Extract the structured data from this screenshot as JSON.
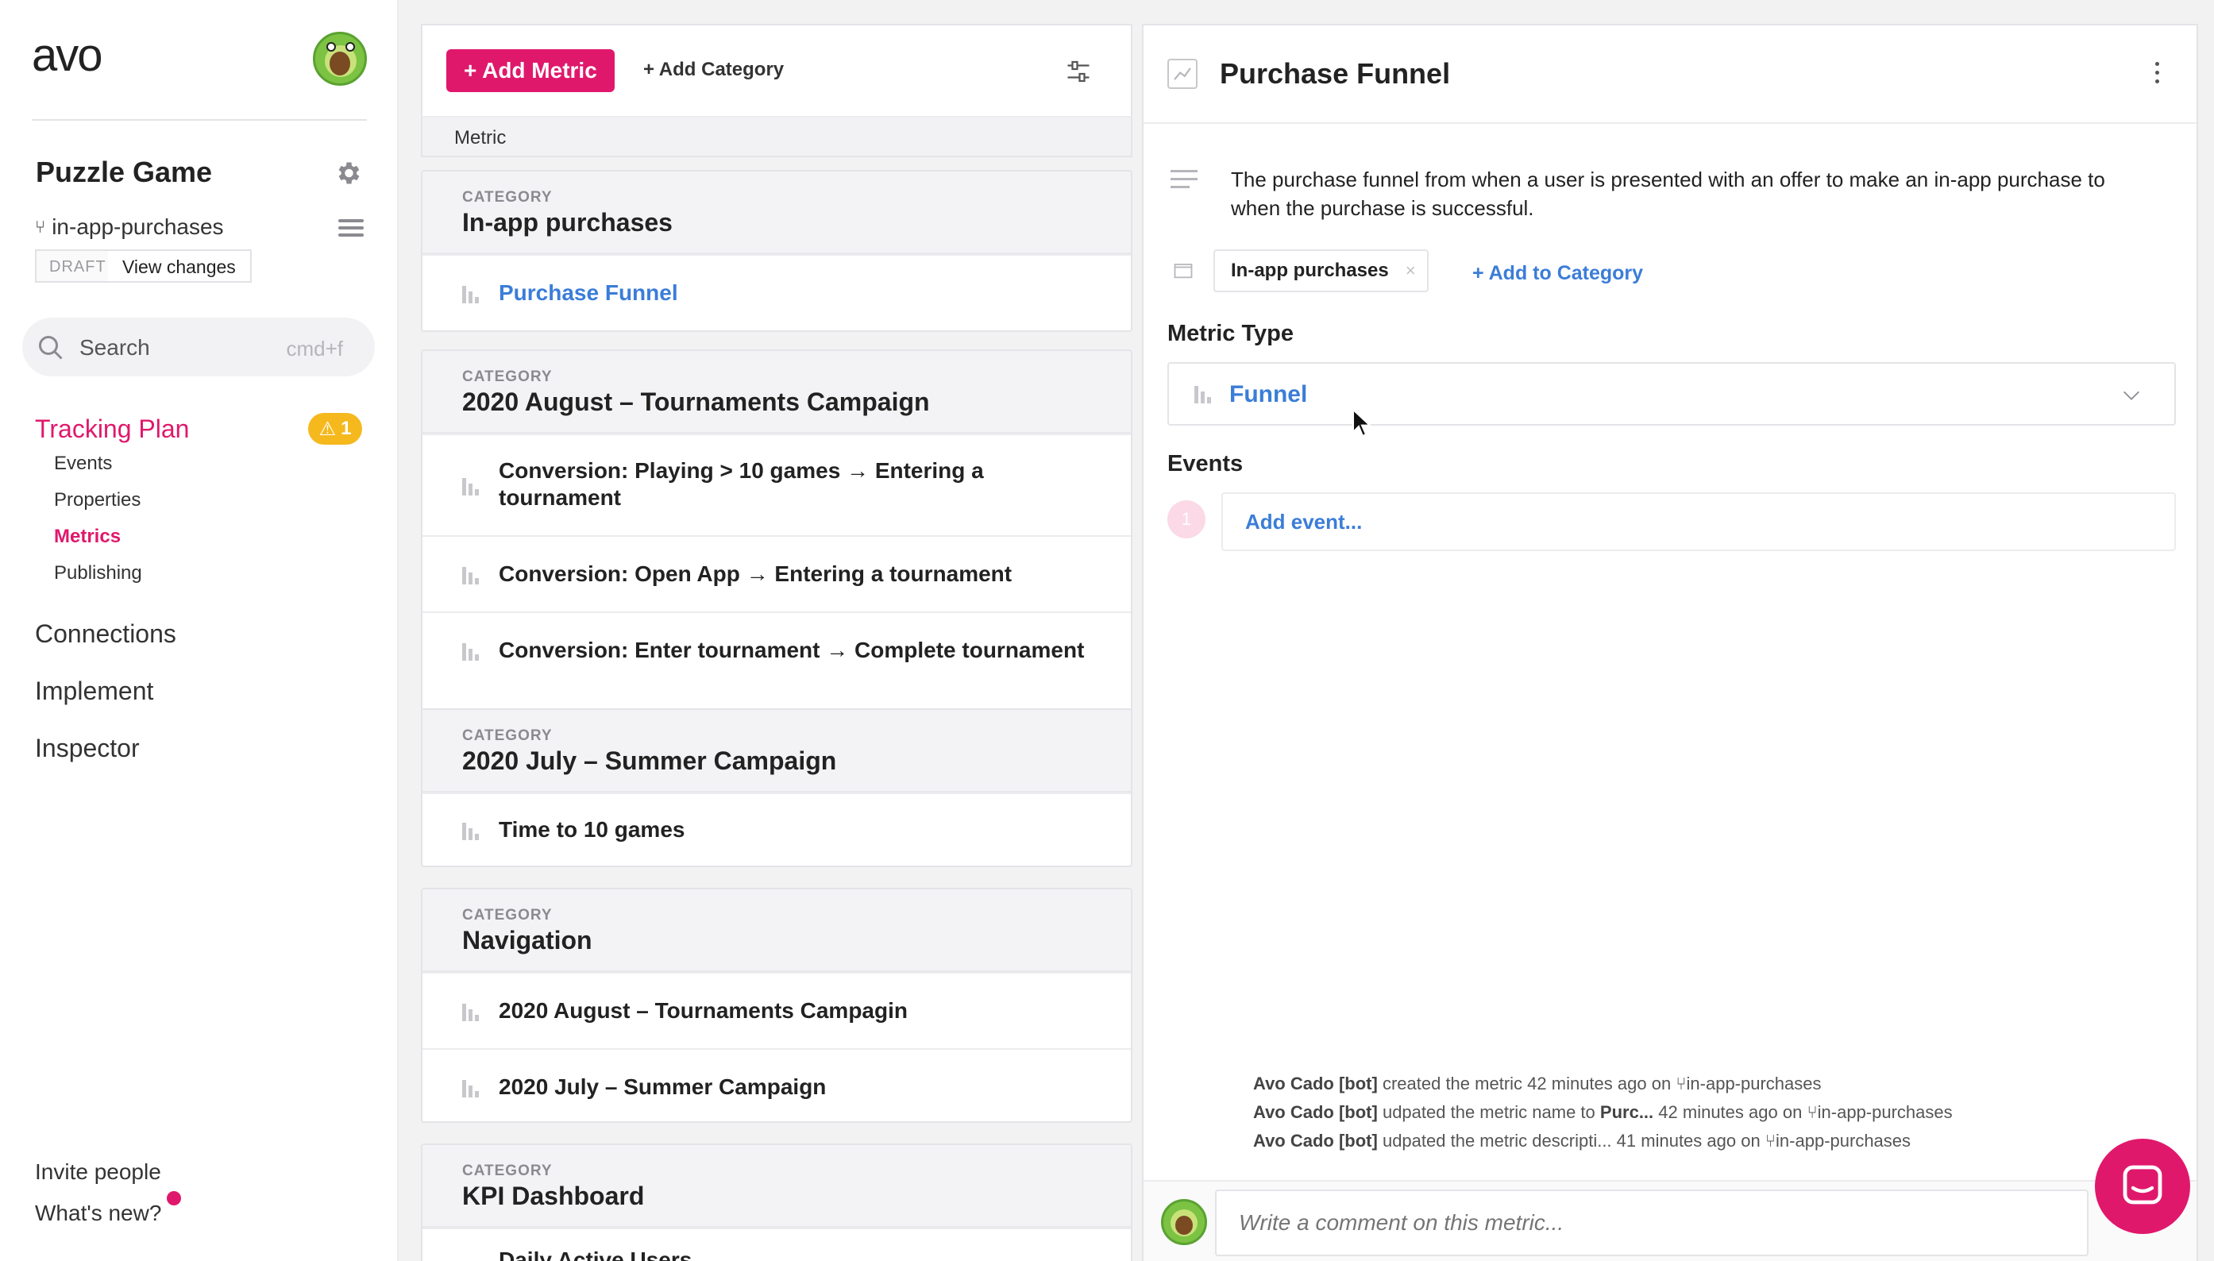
{
  "brand": {
    "logo": "avo",
    "accent": "#e0186c",
    "link": "#3b7dd8"
  },
  "sidebar": {
    "workspace": "Puzzle Game",
    "branch": "in-app-purchases",
    "draft_label": "DRAFT",
    "view_changes": "View changes",
    "search": {
      "label": "Search",
      "hint": "cmd+f"
    },
    "tracking_plan": {
      "label": "Tracking Plan",
      "warning_count": "1"
    },
    "sub_items": [
      {
        "label": "Events"
      },
      {
        "label": "Properties"
      },
      {
        "label": "Metrics"
      },
      {
        "label": "Publishing"
      }
    ],
    "main_items": [
      {
        "label": "Connections"
      },
      {
        "label": "Implement"
      },
      {
        "label": "Inspector"
      }
    ],
    "footer": {
      "invite": "Invite people",
      "whats_new": "What's new?"
    }
  },
  "list": {
    "add_metric": "+ Add Metric",
    "add_category": "+ Add Category",
    "column_header": "Metric",
    "category_label": "CATEGORY",
    "categories": [
      {
        "name": "In-app purchases",
        "metrics": [
          "Purchase Funnel"
        ]
      },
      {
        "name": "2020 August – Tournaments Campaign",
        "metrics": [
          "Conversion: Playing > 10 games → Entering a tournament",
          "Conversion: Open App → Entering a tournament",
          "Conversion: Enter tournament → Complete tournament"
        ]
      },
      {
        "name": "2020 July – Summer Campaign",
        "metrics": [
          "Time to 10 games"
        ]
      },
      {
        "name": "Navigation",
        "metrics": [
          "2020 August – Tournaments Campagin",
          "2020 July – Summer Campaign"
        ]
      },
      {
        "name": "KPI Dashboard",
        "metrics": [
          "Daily Active Users"
        ]
      }
    ]
  },
  "detail": {
    "title": "Purchase Funnel",
    "description": "The purchase funnel from when a user is presented with an offer to make an in-app purchase to when the purchase is successful.",
    "category_tag": "In-app purchases",
    "category_tag_remove": "×",
    "add_to_category": "+ Add to Category",
    "metric_type_label": "Metric Type",
    "metric_type_value": "Funnel",
    "events_label": "Events",
    "event_step": "1",
    "add_event": "Add event...",
    "activity": [
      {
        "user": "Avo Cado [bot]",
        "action": "created the metric",
        "time": "42 minutes ago",
        "on": "on",
        "branch": "in-app-purchases"
      },
      {
        "user": "Avo Cado [bot]",
        "action": "udpated the metric name to",
        "bold": "Purc...",
        "time": "42 minutes ago",
        "on": "on",
        "branch": "in-app-purchases"
      },
      {
        "user": "Avo Cado [bot]",
        "action": "udpated the metric descripti...",
        "time": "41 minutes ago",
        "on": "on",
        "branch": "in-app-purchases"
      }
    ],
    "comment_placeholder": "Write a comment on this metric..."
  }
}
